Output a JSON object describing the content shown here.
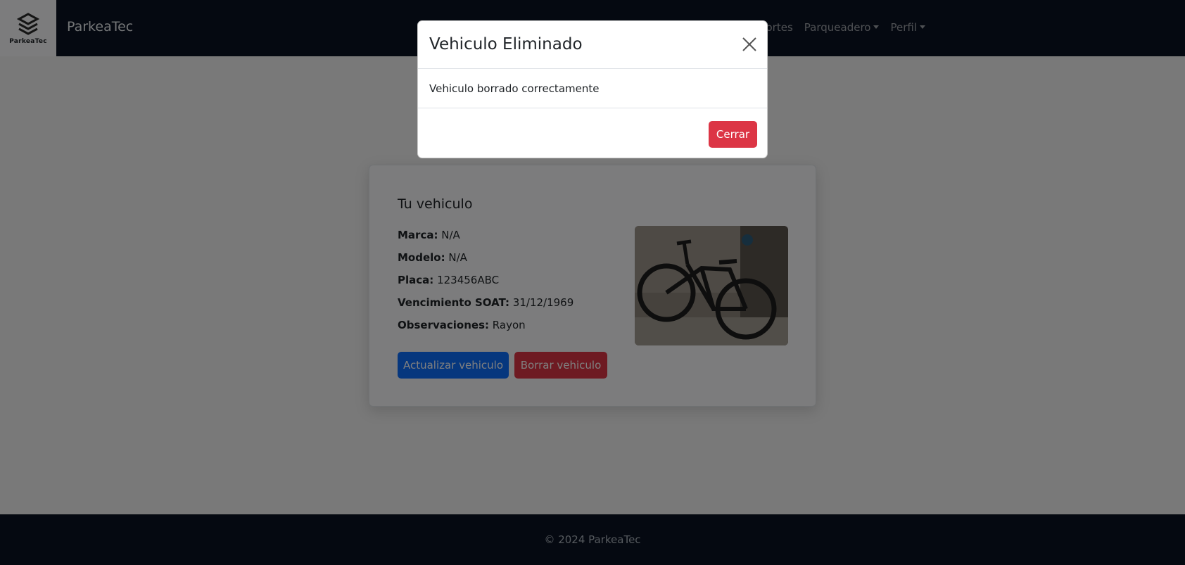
{
  "navbar": {
    "logo_text": "ParkeaTec",
    "brand": "ParkeaTec",
    "links": [
      {
        "label": "Reportes",
        "dropdown": false
      },
      {
        "label": "Parqueadero",
        "dropdown": true
      },
      {
        "label": "Perfil",
        "dropdown": true
      }
    ]
  },
  "card": {
    "title": "Tu vehiculo",
    "fields": [
      {
        "label": "Marca:",
        "value": "N/A"
      },
      {
        "label": "Modelo:",
        "value": "N/A"
      },
      {
        "label": "Placa:",
        "value": "123456ABC"
      },
      {
        "label": "Vencimiento SOAT:",
        "value": "31/12/1969"
      },
      {
        "label": "Observaciones:",
        "value": "Rayon"
      }
    ],
    "update_button": "Actualizar vehiculo",
    "delete_button": "Borrar vehiculo"
  },
  "footer": {
    "text": "© 2024 ParkeaTec"
  },
  "modal": {
    "title": "Vehiculo Eliminado",
    "message": "Vehiculo borrado correctamente",
    "close_button": "Cerrar"
  },
  "colors": {
    "navbar_bg": "#0a1223",
    "primary": "#0d6efd",
    "danger": "#dc3545"
  }
}
